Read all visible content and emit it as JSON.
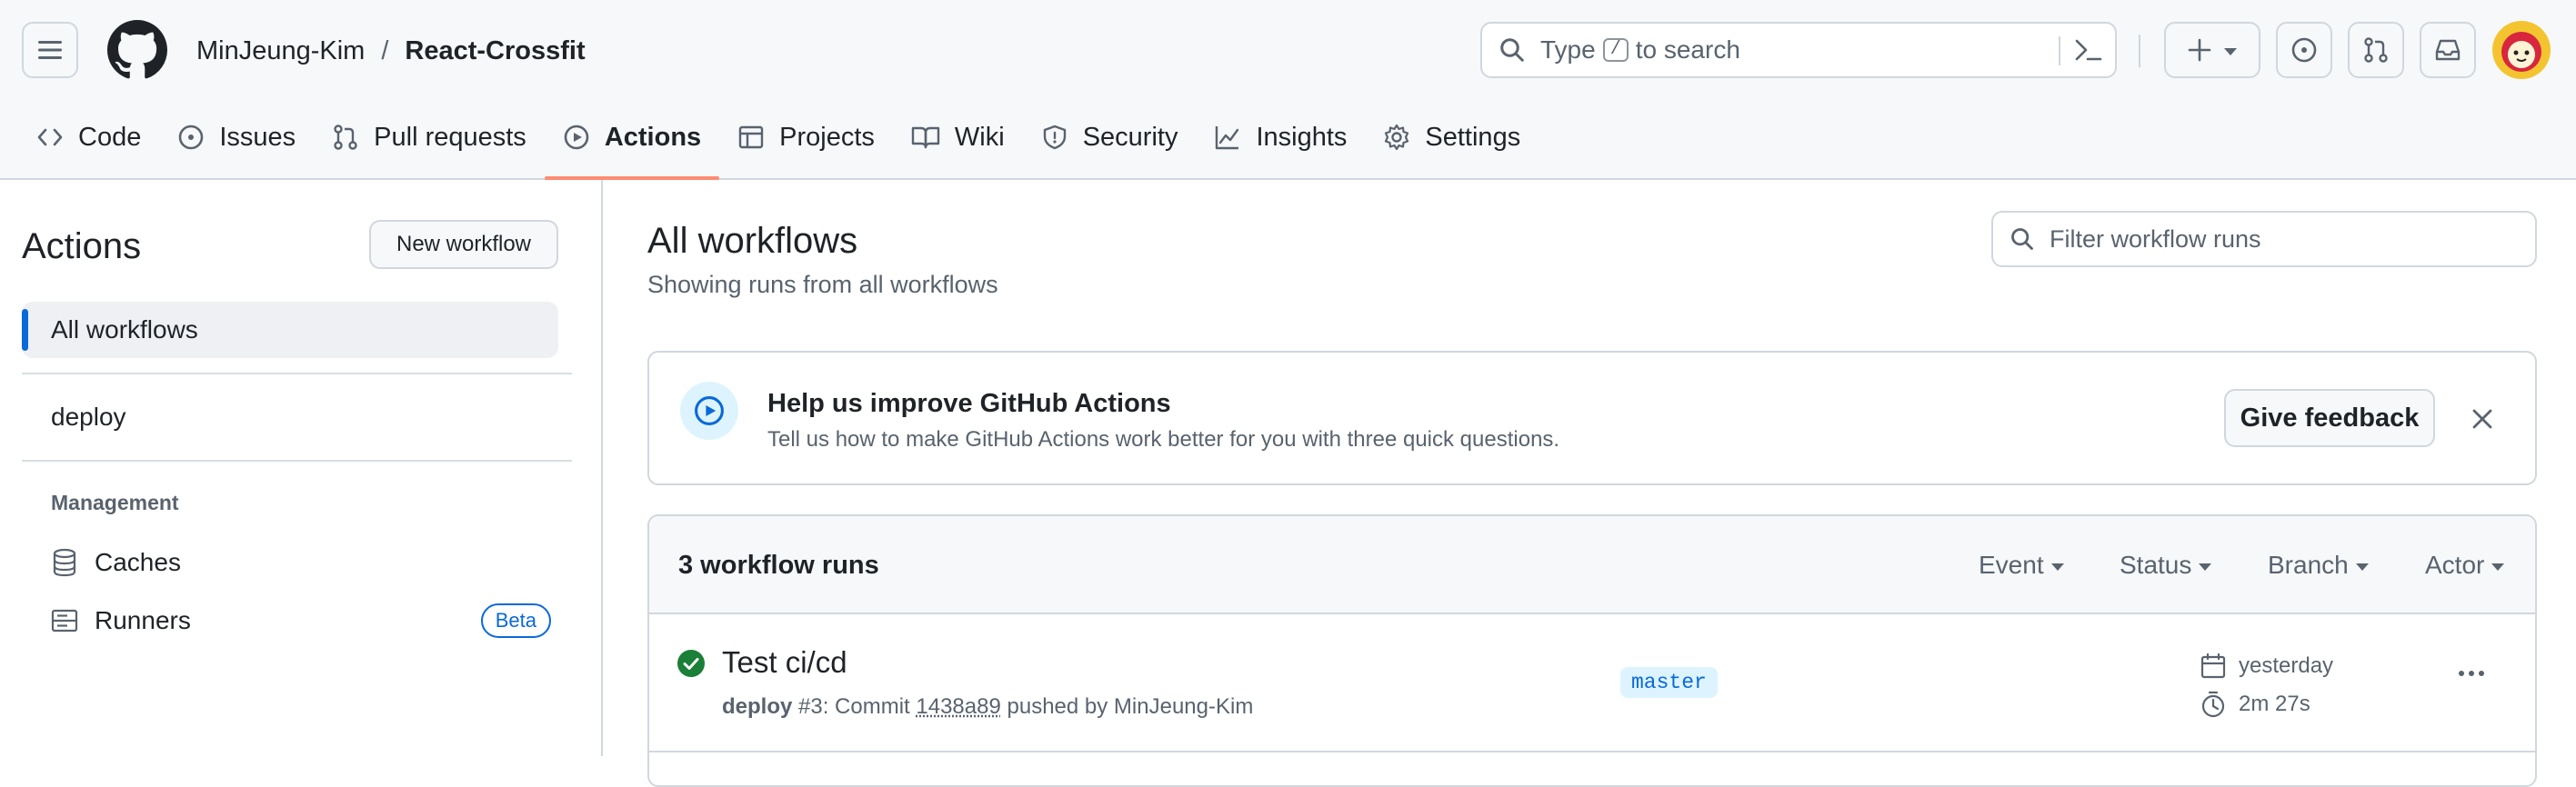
{
  "header": {
    "owner": "MinJeung-Kim",
    "separator": "/",
    "repo": "React-Crossfit",
    "search": {
      "prefix": "Type",
      "key": "/",
      "suffix": "to search"
    }
  },
  "tabs": [
    {
      "label": "Code",
      "icon": "code-icon"
    },
    {
      "label": "Issues",
      "icon": "issue-icon"
    },
    {
      "label": "Pull requests",
      "icon": "pull-request-icon"
    },
    {
      "label": "Actions",
      "icon": "play-icon",
      "active": true
    },
    {
      "label": "Projects",
      "icon": "table-icon"
    },
    {
      "label": "Wiki",
      "icon": "book-icon"
    },
    {
      "label": "Security",
      "icon": "shield-icon"
    },
    {
      "label": "Insights",
      "icon": "graph-icon"
    },
    {
      "label": "Settings",
      "icon": "gear-icon"
    }
  ],
  "sidebar": {
    "title": "Actions",
    "new_workflow": "New workflow",
    "all_workflows": "All workflows",
    "workflows": [
      "deploy"
    ],
    "management_heading": "Management",
    "caches": "Caches",
    "runners": "Runners",
    "beta": "Beta"
  },
  "main": {
    "title": "All workflows",
    "subtitle": "Showing runs from all workflows",
    "filter_placeholder": "Filter workflow runs"
  },
  "banner": {
    "heading": "Help us improve GitHub Actions",
    "description": "Tell us how to make GitHub Actions work better for you with three quick questions.",
    "button": "Give feedback"
  },
  "runs": {
    "count": "3 workflow runs",
    "filters": [
      "Event",
      "Status",
      "Branch",
      "Actor"
    ],
    "items": [
      {
        "title": "Test ci/cd",
        "workflow": "deploy",
        "number": "#3: Commit",
        "sha": "1438a89",
        "pushed_by": "pushed by MinJeung-Kim",
        "branch": "master",
        "when": "yesterday",
        "duration": "2m 27s",
        "status": "success"
      }
    ]
  },
  "colors": {
    "accent": "#0969da",
    "active_tab_underline": "#fd8c73",
    "success": "#1a7f37"
  }
}
